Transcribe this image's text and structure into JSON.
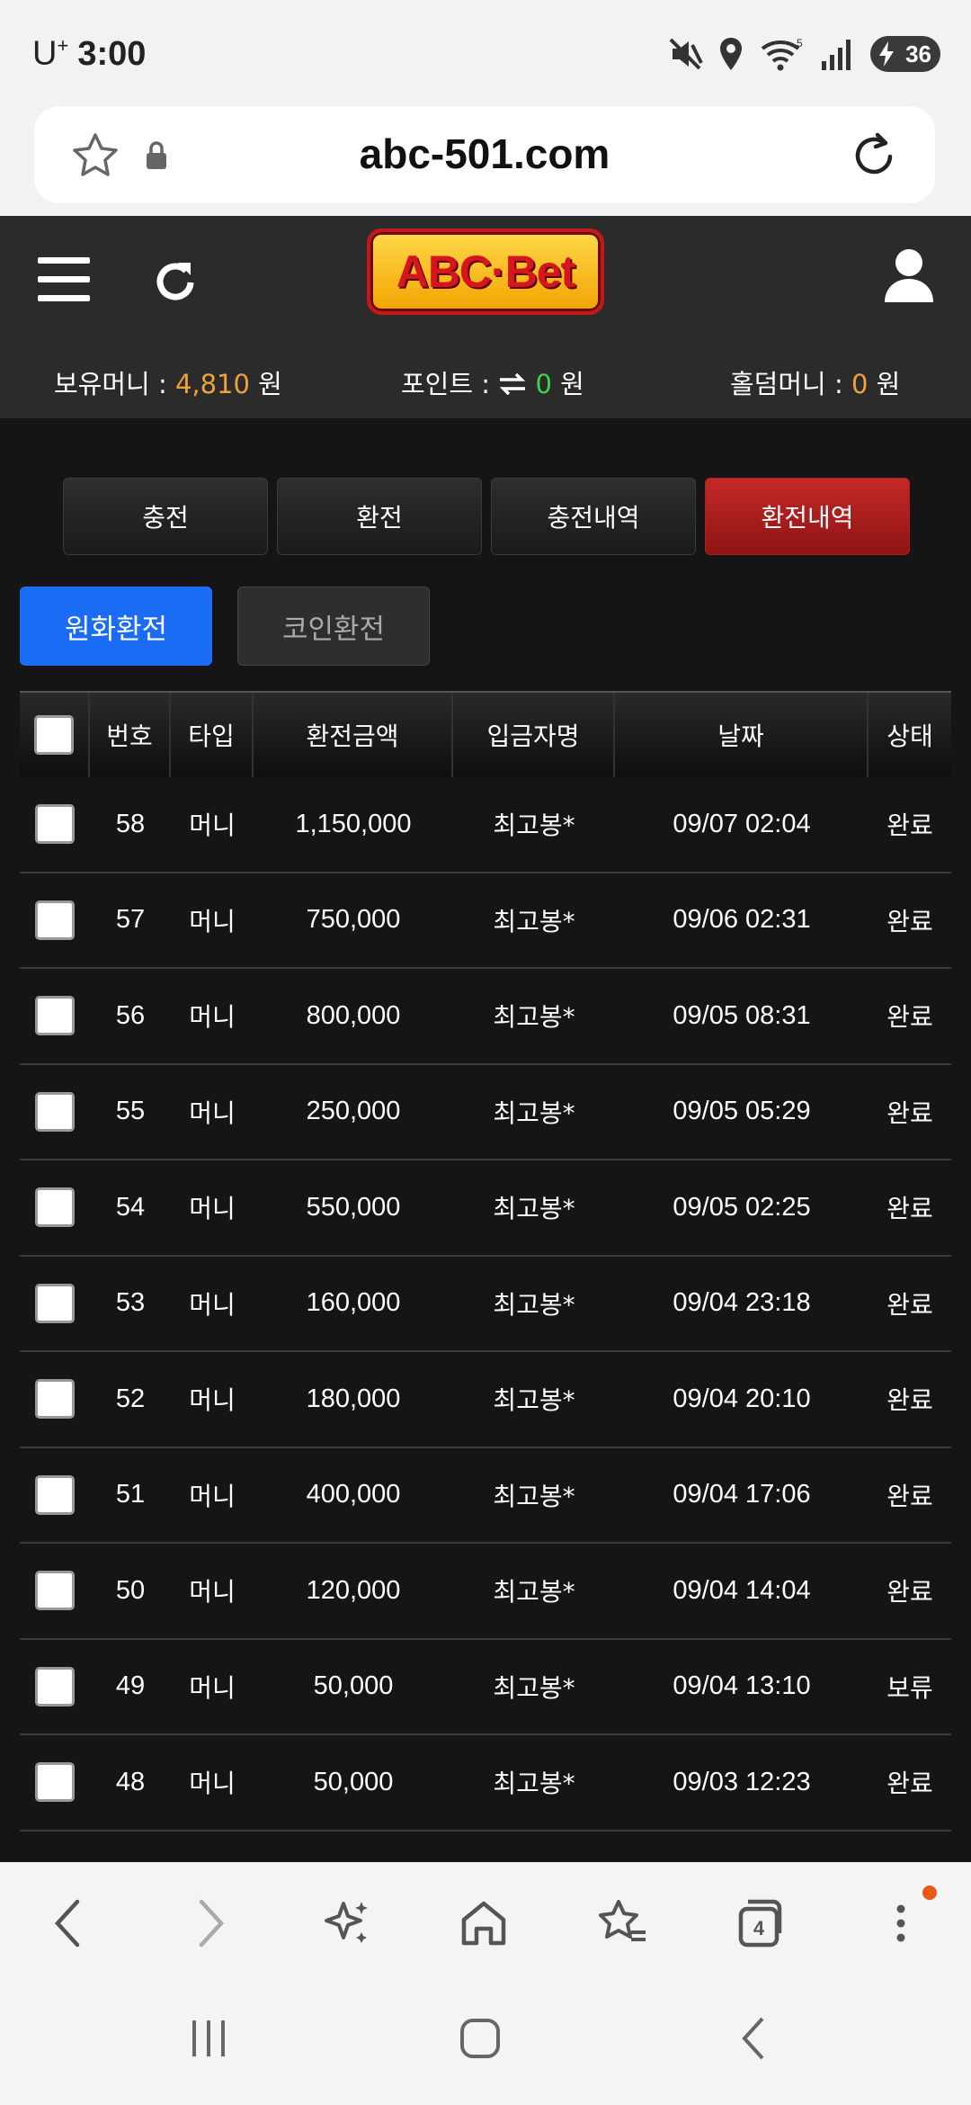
{
  "status_bar": {
    "carrier": "U",
    "carrier_sup": "+",
    "time": "3:00",
    "battery": "36"
  },
  "browser": {
    "url": "abc-501.com"
  },
  "header": {
    "logo_text": "ABC·Bet",
    "balance": {
      "label": "보유머니 : ",
      "value": "4,810",
      "unit": " 원"
    },
    "points": {
      "label": "포인트 : ",
      "value": "0",
      "unit": " 원"
    },
    "holdem": {
      "label": "홀덤머니 : ",
      "value": "0",
      "unit": " 원"
    }
  },
  "tabs": [
    {
      "label": "충전",
      "active": false
    },
    {
      "label": "환전",
      "active": false
    },
    {
      "label": "충전내역",
      "active": false
    },
    {
      "label": "환전내역",
      "active": true
    }
  ],
  "subtabs": [
    {
      "label": "원화환전",
      "active": true
    },
    {
      "label": "코인환전",
      "active": false
    }
  ],
  "table": {
    "headers": [
      "번호",
      "타입",
      "환전금액",
      "입금자명",
      "날짜",
      "상태"
    ],
    "rows": [
      {
        "num": "58",
        "type": "머니",
        "amount": "1,150,000",
        "name": "최고봉*",
        "date": "09/07 02:04",
        "status": "완료"
      },
      {
        "num": "57",
        "type": "머니",
        "amount": "750,000",
        "name": "최고봉*",
        "date": "09/06 02:31",
        "status": "완료"
      },
      {
        "num": "56",
        "type": "머니",
        "amount": "800,000",
        "name": "최고봉*",
        "date": "09/05 08:31",
        "status": "완료"
      },
      {
        "num": "55",
        "type": "머니",
        "amount": "250,000",
        "name": "최고봉*",
        "date": "09/05 05:29",
        "status": "완료"
      },
      {
        "num": "54",
        "type": "머니",
        "amount": "550,000",
        "name": "최고봉*",
        "date": "09/05 02:25",
        "status": "완료"
      },
      {
        "num": "53",
        "type": "머니",
        "amount": "160,000",
        "name": "최고봉*",
        "date": "09/04 23:18",
        "status": "완료"
      },
      {
        "num": "52",
        "type": "머니",
        "amount": "180,000",
        "name": "최고봉*",
        "date": "09/04 20:10",
        "status": "완료"
      },
      {
        "num": "51",
        "type": "머니",
        "amount": "400,000",
        "name": "최고봉*",
        "date": "09/04 17:06",
        "status": "완료"
      },
      {
        "num": "50",
        "type": "머니",
        "amount": "120,000",
        "name": "최고봉*",
        "date": "09/04 14:04",
        "status": "완료"
      },
      {
        "num": "49",
        "type": "머니",
        "amount": "50,000",
        "name": "최고봉*",
        "date": "09/04 13:10",
        "status": "보류"
      },
      {
        "num": "48",
        "type": "머니",
        "amount": "50,000",
        "name": "최고봉*",
        "date": "09/03 12:23",
        "status": "완료"
      }
    ]
  },
  "browser_nav": {
    "tab_count": "4"
  },
  "colors": {
    "accent_red": "#c62828",
    "accent_blue": "#1a6cf5",
    "balance_orange": "#f0a23a",
    "points_green": "#3fd14b"
  }
}
